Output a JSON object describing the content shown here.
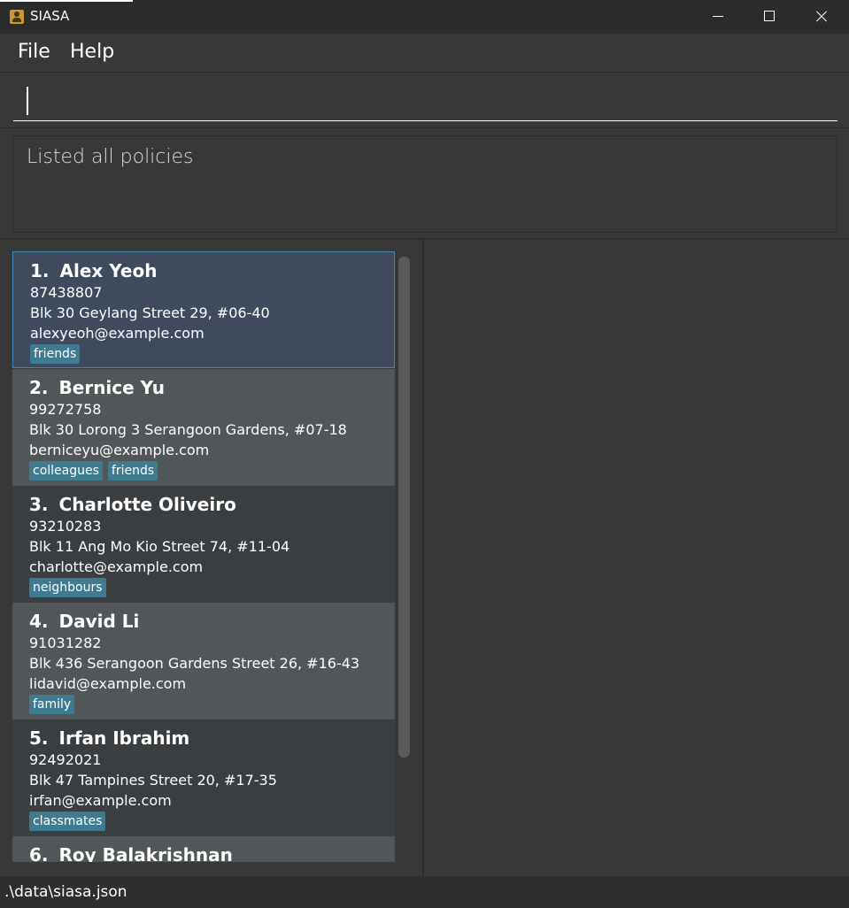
{
  "window": {
    "title": "SIASA",
    "controls": [
      "minimize",
      "maximize",
      "close"
    ]
  },
  "menu": {
    "items": [
      {
        "label": "File"
      },
      {
        "label": "Help"
      }
    ]
  },
  "command": {
    "value": ""
  },
  "result": {
    "message": "Listed all policies"
  },
  "persons": [
    {
      "index": "1.",
      "name": "Alex Yeoh",
      "phone": "87438807",
      "address": "Blk 30 Geylang Street 29, #06-40",
      "email": "alexyeoh@example.com",
      "tags": [
        "friends"
      ]
    },
    {
      "index": "2.",
      "name": "Bernice Yu",
      "phone": "99272758",
      "address": "Blk 30 Lorong 3 Serangoon Gardens, #07-18",
      "email": "berniceyu@example.com",
      "tags": [
        "colleagues",
        "friends"
      ]
    },
    {
      "index": "3.",
      "name": "Charlotte Oliveiro",
      "phone": "93210283",
      "address": "Blk 11 Ang Mo Kio Street 74, #11-04",
      "email": "charlotte@example.com",
      "tags": [
        "neighbours"
      ]
    },
    {
      "index": "4.",
      "name": "David Li",
      "phone": "91031282",
      "address": "Blk 436 Serangoon Gardens Street 26, #16-43",
      "email": "lidavid@example.com",
      "tags": [
        "family"
      ]
    },
    {
      "index": "5.",
      "name": "Irfan Ibrahim",
      "phone": "92492021",
      "address": "Blk 47 Tampines Street 20, #17-35",
      "email": "irfan@example.com",
      "tags": [
        "classmates"
      ]
    },
    {
      "index": "6.",
      "name": "Roy Balakrishnan"
    }
  ],
  "status": {
    "path": ".\\data\\siasa.json"
  },
  "colors": {
    "background": "#383838",
    "titlebar": "#2b2b2b",
    "card_odd": "#3b3e40",
    "card_even": "#515658",
    "card_selected": "#3f4a5d",
    "selected_border": "#3a8ab4",
    "tag": "#3e7b91"
  },
  "icons": {
    "app": "address-book-icon"
  }
}
